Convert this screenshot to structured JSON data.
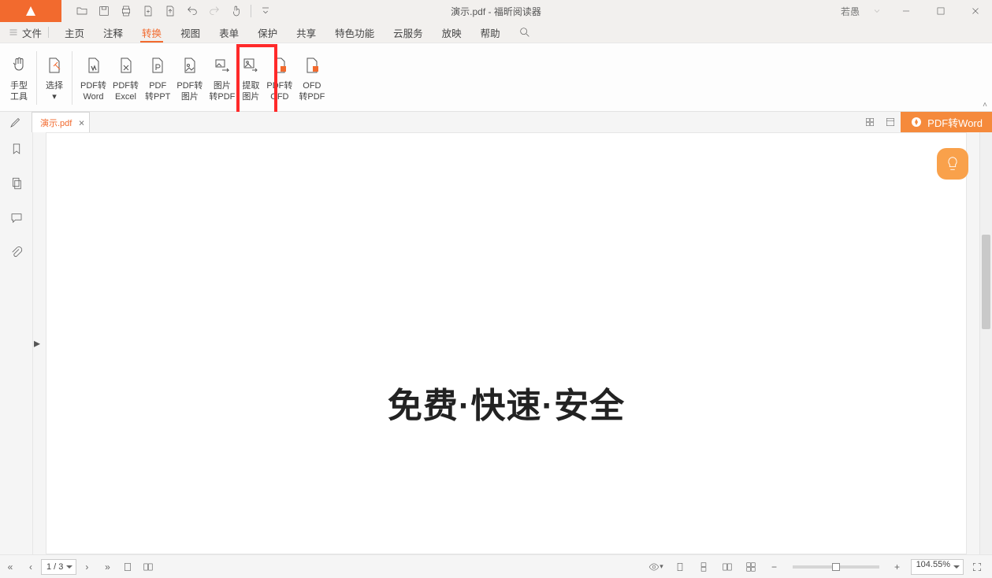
{
  "title_bar": {
    "document_title": "演示.pdf - 福昕阅读器",
    "user_name": "若愚"
  },
  "menu": {
    "file": "文件",
    "tabs": [
      "主页",
      "注释",
      "转换",
      "视图",
      "表单",
      "保护",
      "共享",
      "特色功能",
      "云服务",
      "放映",
      "帮助"
    ],
    "active_index": 2
  },
  "ribbon": {
    "items": [
      {
        "l1": "手型",
        "l2": "工具"
      },
      {
        "l1": "选择",
        "l2": "▾"
      },
      {
        "l1": "PDF转",
        "l2": "Word"
      },
      {
        "l1": "PDF转",
        "l2": "Excel"
      },
      {
        "l1": "PDF",
        "l2": "转PPT"
      },
      {
        "l1": "PDF转",
        "l2": "图片"
      },
      {
        "l1": "图片",
        "l2": "转PDF"
      },
      {
        "l1": "提取",
        "l2": "图片"
      },
      {
        "l1": "PDF转",
        "l2": "OFD"
      },
      {
        "l1": "OFD",
        "l2": "转PDF"
      }
    ],
    "highlighted_index": 7
  },
  "doc_tab": {
    "name": "演示.pdf"
  },
  "promo_button": {
    "label": "PDF转Word"
  },
  "page_content": {
    "headline": "免费·快速·安全"
  },
  "status_bar": {
    "page_indicator": "1 / 3",
    "zoom_value": "104.55%"
  }
}
